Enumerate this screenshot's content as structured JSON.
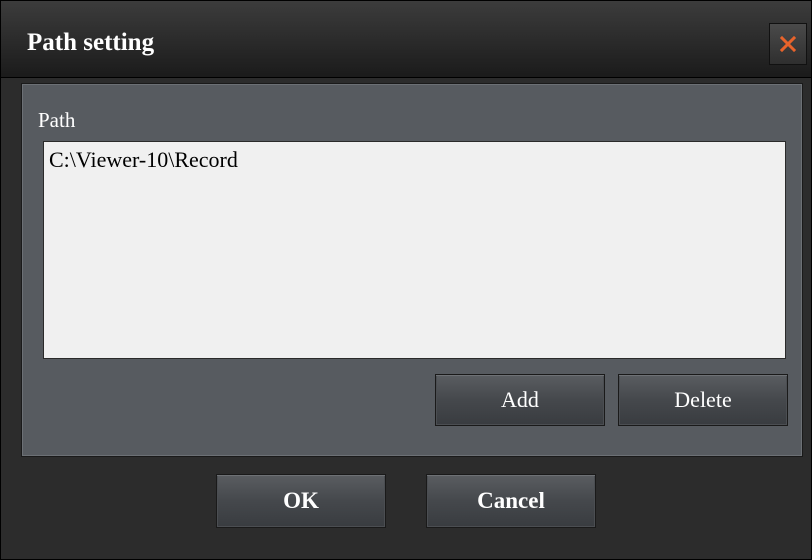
{
  "window": {
    "title": "Path setting",
    "close_icon": "close-icon",
    "close_color": "#e8632b"
  },
  "panel": {
    "label": "Path",
    "paths": [
      "C:\\Viewer-10\\Record"
    ],
    "add_label": "Add",
    "delete_label": "Delete"
  },
  "footer": {
    "ok_label": "OK",
    "cancel_label": "Cancel"
  }
}
